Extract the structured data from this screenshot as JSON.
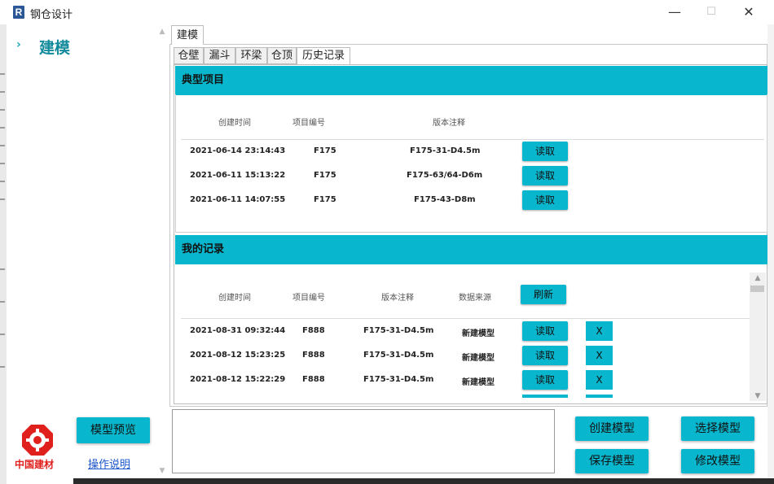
{
  "window": {
    "title": "钢仓设计",
    "logo_letter": "R",
    "minimize_glyph": "—",
    "maximize_glyph": "☐",
    "close_glyph": "✕"
  },
  "sidebar": {
    "chevron": "›",
    "title": "建模",
    "preview_button": "模型预览",
    "help_link": "操作说明",
    "brand_text": "中国建材",
    "brand_color": "#e0201c"
  },
  "main_tab": "建模",
  "sub_tabs": [
    "仓壁",
    "漏斗",
    "环梁",
    "仓顶",
    "历史记录"
  ],
  "active_sub_tab": "历史记录",
  "typical": {
    "header": "典型项目",
    "columns": [
      "创建时间",
      "项目编号",
      "版本注释"
    ],
    "rows": [
      {
        "time": "2021-06-14 23:14:43",
        "code": "F175",
        "note": "F175-31-D4.5m",
        "action": "读取"
      },
      {
        "time": "2021-06-11 15:13:22",
        "code": "F175",
        "note": "F175-63/64-D6m",
        "action": "读取"
      },
      {
        "time": "2021-06-11 14:07:55",
        "code": "F175",
        "note": "F175-43-D8m",
        "action": "读取"
      }
    ]
  },
  "mine": {
    "header": "我的记录",
    "columns": [
      "创建时间",
      "项目编号",
      "版本注释",
      "数据来源"
    ],
    "refresh_button": "刷新",
    "rows": [
      {
        "time": "2021-08-31 09:32:44",
        "code": "F888",
        "note": "F175-31-D4.5m",
        "source": "新建模型",
        "action": "读取",
        "delete": "X"
      },
      {
        "time": "2021-08-12 15:23:25",
        "code": "F888",
        "note": "F175-31-D4.5m",
        "source": "新建模型",
        "action": "读取",
        "delete": "X"
      },
      {
        "time": "2021-08-12 15:22:29",
        "code": "F888",
        "note": "F175-31-D4.5m",
        "source": "新建模型",
        "action": "读取",
        "delete": "X"
      }
    ]
  },
  "actions": {
    "create": "创建模型",
    "select": "选择模型",
    "save": "保存模型",
    "modify": "修改模型"
  },
  "colors": {
    "accent": "#08b6cd",
    "sidebar_title": "#138b9c",
    "link": "#1a55c9"
  }
}
